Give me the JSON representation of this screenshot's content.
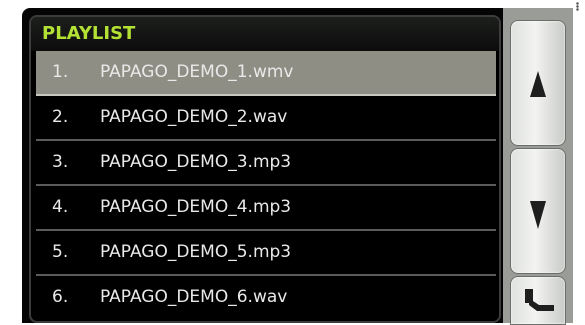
{
  "playlist": {
    "title": "PLAYLIST",
    "items": [
      {
        "num": "1.",
        "name": "PAPAGO_DEMO_1.wmv",
        "selected": true
      },
      {
        "num": "2.",
        "name": "PAPAGO_DEMO_2.wav",
        "selected": false
      },
      {
        "num": "3.",
        "name": "PAPAGO_DEMO_3.mp3",
        "selected": false
      },
      {
        "num": "4.",
        "name": "PAPAGO_DEMO_4.mp3",
        "selected": false
      },
      {
        "num": "5.",
        "name": "PAPAGO_DEMO_5.mp3",
        "selected": false
      },
      {
        "num": "6.",
        "name": "PAPAGO_DEMO_6.wav",
        "selected": false
      }
    ]
  },
  "controls": {
    "up_icon": "up-arrow-icon",
    "down_icon": "down-arrow-icon",
    "back_icon": "back-arrow-icon"
  },
  "colors": {
    "title_text": "#b4e234",
    "selected_row": "#8e8e84",
    "list_text": "#e9e9e9",
    "background": "#000000"
  }
}
